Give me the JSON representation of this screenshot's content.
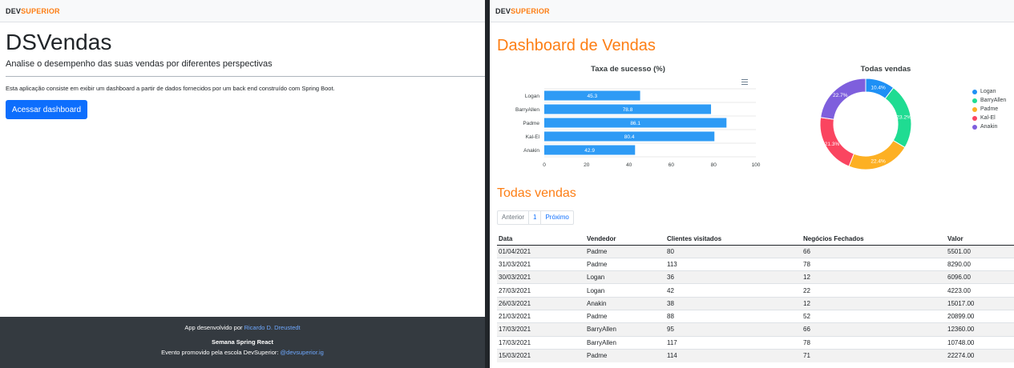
{
  "left": {
    "brand": {
      "dev": "DEV",
      "superior": "SUPERIOR"
    },
    "title": "DSVendas",
    "lead": "Analise o desempenho das suas vendas por diferentes perspectivas",
    "info": "Esta aplicação consiste em exibir um dashboard a partir de dados fornecidos por um back end construído com Spring Boot.",
    "button": "Acessar dashboard",
    "footer": {
      "line1_prefix": "App desenvolvido por ",
      "author": "Ricardo D. Dreustedt",
      "line2": "Semana Spring React",
      "line3_prefix": "Evento promovido pela escola DevSuperior: ",
      "instagram": "@devsuperior.ig"
    }
  },
  "right": {
    "brand": {
      "dev": "DEV",
      "superior": "SUPERIOR"
    },
    "title": "Dashboard de Vendas",
    "section_title": "Todas vendas",
    "pagination": {
      "prev": "Anterior",
      "page": "1",
      "next": "Próximo"
    },
    "table": {
      "headers": [
        "Data",
        "Vendedor",
        "Clientes visitados",
        "Negócios Fechados",
        "Valor"
      ],
      "rows": [
        [
          "01/04/2021",
          "Padme",
          "80",
          "66",
          "5501.00"
        ],
        [
          "31/03/2021",
          "Padme",
          "113",
          "78",
          "8290.00"
        ],
        [
          "30/03/2021",
          "Logan",
          "36",
          "12",
          "6096.00"
        ],
        [
          "27/03/2021",
          "Logan",
          "42",
          "22",
          "4223.00"
        ],
        [
          "26/03/2021",
          "Anakin",
          "38",
          "12",
          "15017.00"
        ],
        [
          "21/03/2021",
          "Padme",
          "88",
          "52",
          "20899.00"
        ],
        [
          "17/03/2021",
          "BarryAllen",
          "95",
          "66",
          "12360.00"
        ],
        [
          "17/03/2021",
          "BarryAllen",
          "117",
          "78",
          "10748.00"
        ],
        [
          "15/03/2021",
          "Padme",
          "114",
          "71",
          "22274.00"
        ]
      ]
    }
  },
  "chart_data": [
    {
      "type": "bar",
      "orientation": "horizontal",
      "title": "Taxa de sucesso (%)",
      "categories": [
        "Logan",
        "BarryAllen",
        "Padme",
        "Kal-El",
        "Anakin"
      ],
      "values": [
        45.3,
        78.8,
        86.1,
        80.4,
        42.9
      ],
      "value_labels": [
        "45.3",
        "78.8",
        "86.1",
        "80.4",
        "42.9"
      ],
      "xlim": [
        0,
        100
      ],
      "xticks": [
        "0",
        "20",
        "40",
        "60",
        "80",
        "100"
      ],
      "color": "#2e9bf5",
      "grid": true
    },
    {
      "type": "pie",
      "donut": true,
      "title": "Todas vendas",
      "labels": [
        "Logan",
        "BarryAllen",
        "Padme",
        "Kal-El",
        "Anakin"
      ],
      "values": [
        10.4,
        23.2,
        22.4,
        21.3,
        22.7
      ],
      "value_labels": [
        "10.4%",
        "23.2%",
        "22.4%",
        "21.3%",
        "22.7%"
      ],
      "colors": [
        "#1e90f5",
        "#1fdc92",
        "#fdb023",
        "#fa4560",
        "#7e5fdd"
      ],
      "legend": "right"
    }
  ]
}
